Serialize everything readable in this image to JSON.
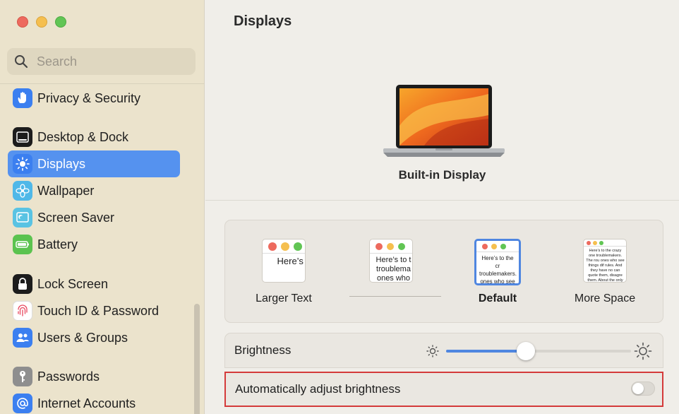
{
  "window": {
    "title": "Displays"
  },
  "search": {
    "placeholder": "Search"
  },
  "sidebar": {
    "items": [
      {
        "label": "Privacy & Security",
        "icon": "hand-icon",
        "color": "#3b7ff0"
      },
      {
        "label": "Desktop & Dock",
        "icon": "dock-icon",
        "color": "#1c1c1c"
      },
      {
        "label": "Displays",
        "icon": "sun-icon",
        "color": "#3b7ff0",
        "selected": true
      },
      {
        "label": "Wallpaper",
        "icon": "flower-icon",
        "color": "#4fb8e8"
      },
      {
        "label": "Screen Saver",
        "icon": "screensaver-icon",
        "color": "#59c3e3"
      },
      {
        "label": "Battery",
        "icon": "battery-icon",
        "color": "#5bc34f"
      },
      {
        "label": "Lock Screen",
        "icon": "lock-icon",
        "color": "#1c1c1c"
      },
      {
        "label": "Touch ID & Password",
        "icon": "fingerprint-icon",
        "color": "#ffffff"
      },
      {
        "label": "Users & Groups",
        "icon": "users-icon",
        "color": "#3b7ff0"
      },
      {
        "label": "Passwords",
        "icon": "key-icon",
        "color": "#8e8e8e"
      },
      {
        "label": "Internet Accounts",
        "icon": "at-icon",
        "color": "#3b7ff0"
      }
    ]
  },
  "display": {
    "name": "Built-in Display"
  },
  "resolution": {
    "options": [
      {
        "label": "Larger Text",
        "preview": "Here’s to troublem",
        "selected": false
      },
      {
        "label": "",
        "preview": "Here’s to t troublema ones who",
        "selected": false
      },
      {
        "label": "Default",
        "preview": "Here’s to the cr troublemakers. ones who see th rules. And they",
        "selected": true
      },
      {
        "label": "More Space",
        "preview": "Here’s to the crazy one troublemakers. The rou ones who see things dif rules. And they have no can quote them, disagre them. About the only thi Because they change thi",
        "selected": false
      }
    ]
  },
  "brightness": {
    "label": "Brightness",
    "level": 0.43
  },
  "auto_brightness": {
    "label": "Automatically adjust brightness",
    "enabled": false
  },
  "colors": {
    "accent": "#5592ef",
    "highlight_box": "#d43a3a"
  }
}
